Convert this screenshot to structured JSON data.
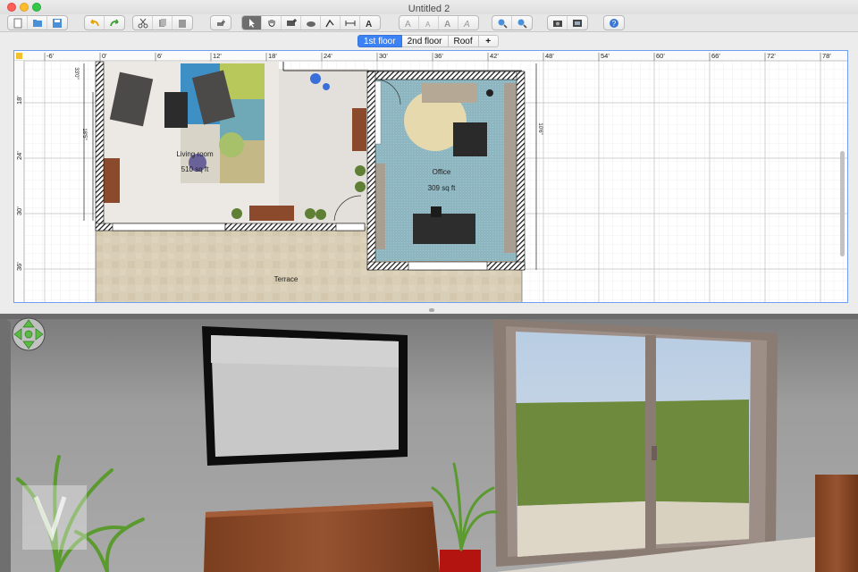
{
  "window": {
    "title": "Untitled 2"
  },
  "toolbar": {
    "groups": [
      [
        "new-file-icon",
        "open-file-icon",
        "save-file-icon"
      ],
      [
        "undo-icon",
        "redo-icon"
      ],
      [
        "cut-icon",
        "copy-icon",
        "paste-icon"
      ],
      [
        "add-furniture-icon"
      ],
      [
        "select-arrow-icon",
        "pan-hand-icon",
        "create-walls-icon",
        "create-rooms-icon",
        "create-polylines-icon",
        "create-dimensions-icon",
        "add-text-icon"
      ],
      [
        "increase-text-icon",
        "decrease-text-icon",
        "bold-text-icon",
        "italic-text-icon"
      ],
      [
        "zoom-in-icon",
        "zoom-out-icon"
      ],
      [
        "create-photo-icon",
        "create-video-icon"
      ],
      [
        "help-icon"
      ]
    ]
  },
  "levels": {
    "tabs": [
      "1st floor",
      "2nd floor",
      "Roof"
    ],
    "selected": "1st floor",
    "add_label": "+"
  },
  "plan": {
    "ruler_labels": [
      "-6'",
      "0'",
      "6'",
      "12'",
      "18'",
      "24'",
      "30'",
      "36'",
      "42'",
      "48'",
      "54'",
      "60'",
      "66'",
      "72'",
      "78'"
    ],
    "vertical_ruler_labels": [
      "18'",
      "24'",
      "30'",
      "36'"
    ],
    "rooms": [
      {
        "name": "Living room",
        "area": "510 sq ft"
      },
      {
        "name": "Office",
        "area": "309 sq ft"
      },
      {
        "name": "Terrace",
        "area": ""
      }
    ],
    "dimensions": [
      "33'0\"",
      "18'5\"",
      "10'6\""
    ]
  },
  "colors": {
    "selected_tab": "#3b82f6",
    "plan_border": "#6e9ff0",
    "office_floor": "#8fb7c2",
    "terrace": "#d7cbb3",
    "wall_3d": "#9b9b9b",
    "grass": "#6f8a3e"
  }
}
